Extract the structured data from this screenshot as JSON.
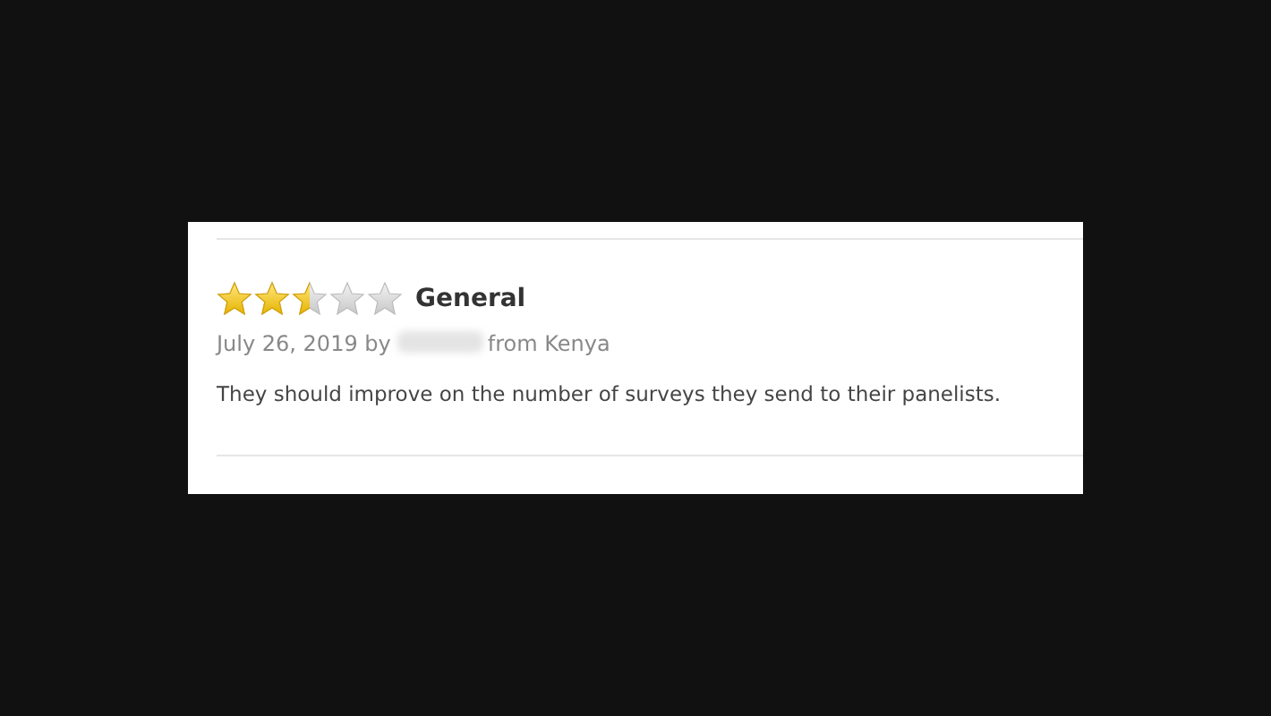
{
  "review": {
    "stars": 2.5,
    "title": "General",
    "date_by": "July 26, 2019 by",
    "author_redacted": true,
    "location": "from Kenya",
    "text": "They should improve on the number of surveys they send to their panelists."
  }
}
